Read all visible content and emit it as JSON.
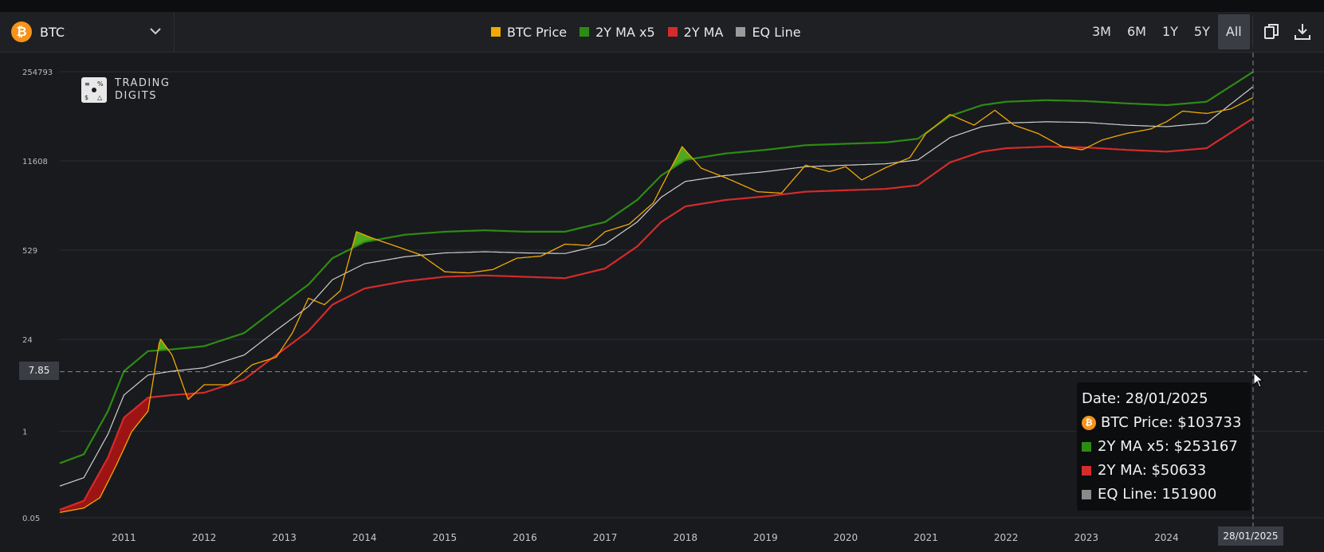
{
  "toolbar": {
    "asset": "BTC",
    "coin_symbol": "₿",
    "legend": [
      {
        "label": "BTC Price",
        "color": "#f2a900"
      },
      {
        "label": "2Y MA x5",
        "color": "#2e8b12"
      },
      {
        "label": "2Y MA",
        "color": "#d42b2b"
      },
      {
        "label": "EQ Line",
        "color": "#9a9a9a"
      }
    ],
    "ranges": [
      "3M",
      "6M",
      "1Y",
      "5Y",
      "All"
    ],
    "active_range": "All",
    "tools": [
      "copy-icon",
      "download-icon"
    ]
  },
  "watermark": {
    "line1": "TRADING",
    "line2": "DIGITS"
  },
  "crosshair": {
    "y_value": "7.85",
    "date": "28/01/2025"
  },
  "tooltip": {
    "date": "Date: 28/01/2025",
    "btc_price": "BTC Price: $103733",
    "ma5": "2Y MA x5: $253167",
    "ma": "2Y MA: $50633",
    "eq": "EQ Line: 151900"
  },
  "chart_data": {
    "type": "line",
    "y_scale": "log",
    "ylim": [
      0.05,
      254793
    ],
    "ytick_labels": [
      "254793",
      "11608",
      "529",
      "24",
      "1",
      "0.05"
    ],
    "xtick_labels": [
      "2011",
      "2012",
      "2013",
      "2014",
      "2015",
      "2016",
      "2017",
      "2018",
      "2019",
      "2020",
      "2021",
      "2022",
      "2023",
      "2024"
    ],
    "x_range": [
      2010.2,
      2025.08
    ],
    "grid": true,
    "legend_position": "top-center",
    "series": [
      {
        "name": "2Y MA x5",
        "color": "#2e8b12",
        "x": [
          2010.2,
          2010.5,
          2010.8,
          2011.0,
          2011.3,
          2011.6,
          2012.0,
          2012.5,
          2012.9,
          2013.3,
          2013.6,
          2014.0,
          2014.5,
          2015.0,
          2015.5,
          2016.0,
          2016.5,
          2017.0,
          2017.4,
          2017.7,
          2018.0,
          2018.5,
          2019.0,
          2019.5,
          2020.0,
          2020.5,
          2020.9,
          2021.3,
          2021.7,
          2022.0,
          2022.5,
          2023.0,
          2023.5,
          2024.0,
          2024.5,
          2025.08
        ],
        "values": [
          0.33,
          0.45,
          2.0,
          8.0,
          16,
          17,
          19,
          30,
          70,
          160,
          400,
          700,
          900,
          1000,
          1050,
          1000,
          1000,
          1400,
          3000,
          7000,
          12000,
          15000,
          17000,
          20000,
          21000,
          22000,
          25000,
          55000,
          80000,
          90000,
          95000,
          92000,
          85000,
          80000,
          90000,
          253167
        ]
      },
      {
        "name": "EQ Line",
        "color": "#cfcfcf",
        "x": [
          2010.2,
          2010.5,
          2010.8,
          2011.0,
          2011.3,
          2011.6,
          2012.0,
          2012.5,
          2012.9,
          2013.3,
          2013.6,
          2014.0,
          2014.5,
          2015.0,
          2015.5,
          2016.0,
          2016.5,
          2017.0,
          2017.4,
          2017.7,
          2018.0,
          2018.5,
          2019.0,
          2019.5,
          2020.0,
          2020.5,
          2020.9,
          2021.3,
          2021.7,
          2022.0,
          2022.5,
          2023.0,
          2023.5,
          2024.0,
          2024.5,
          2025.08
        ],
        "values": [
          0.15,
          0.2,
          0.9,
          3.5,
          7,
          8,
          9,
          14,
          33,
          75,
          190,
          330,
          420,
          480,
          500,
          480,
          470,
          650,
          1400,
          3300,
          5700,
          7000,
          8000,
          9500,
          10000,
          10500,
          12000,
          26000,
          38000,
          43000,
          45000,
          44000,
          40000,
          38000,
          43000,
          151900
        ]
      },
      {
        "name": "2Y MA",
        "color": "#d42b2b",
        "x": [
          2010.2,
          2010.5,
          2010.8,
          2011.0,
          2011.3,
          2011.6,
          2012.0,
          2012.5,
          2012.9,
          2013.3,
          2013.6,
          2014.0,
          2014.5,
          2015.0,
          2015.5,
          2016.0,
          2016.5,
          2017.0,
          2017.4,
          2017.7,
          2018.0,
          2018.5,
          2019.0,
          2019.5,
          2020.0,
          2020.5,
          2020.9,
          2021.3,
          2021.7,
          2022.0,
          2022.5,
          2023.0,
          2023.5,
          2024.0,
          2024.5,
          2025.08
        ],
        "values": [
          0.066,
          0.09,
          0.4,
          1.6,
          3.2,
          3.5,
          3.8,
          6,
          14,
          32,
          80,
          140,
          180,
          210,
          220,
          210,
          200,
          280,
          600,
          1400,
          2400,
          3000,
          3400,
          4000,
          4200,
          4400,
          5000,
          11000,
          16000,
          18000,
          19000,
          18500,
          17000,
          16000,
          18000,
          50633
        ]
      },
      {
        "name": "BTC Price",
        "color": "#f2a900",
        "x": [
          2010.2,
          2010.5,
          2010.7,
          2010.9,
          2011.1,
          2011.3,
          2011.45,
          2011.6,
          2011.8,
          2012.0,
          2012.3,
          2012.6,
          2012.9,
          2013.1,
          2013.3,
          2013.5,
          2013.7,
          2013.9,
          2014.1,
          2014.4,
          2014.7,
          2015.0,
          2015.3,
          2015.6,
          2015.9,
          2016.2,
          2016.5,
          2016.8,
          2017.0,
          2017.3,
          2017.6,
          2017.96,
          2018.2,
          2018.5,
          2018.9,
          2019.2,
          2019.5,
          2019.8,
          2020.0,
          2020.2,
          2020.5,
          2020.8,
          2021.0,
          2021.3,
          2021.6,
          2021.86,
          2022.1,
          2022.4,
          2022.7,
          2022.95,
          2023.2,
          2023.5,
          2023.8,
          2024.0,
          2024.2,
          2024.5,
          2024.8,
          2025.08
        ],
        "values": [
          0.06,
          0.07,
          0.1,
          0.3,
          1,
          2,
          25,
          14,
          3,
          5,
          5,
          10,
          13,
          30,
          100,
          80,
          130,
          1000,
          800,
          600,
          450,
          250,
          240,
          270,
          400,
          430,
          650,
          620,
          1000,
          1300,
          2700,
          19000,
          9000,
          6500,
          4000,
          3800,
          10000,
          8000,
          9500,
          6000,
          9200,
          13000,
          30000,
          58000,
          40000,
          67000,
          40000,
          30000,
          19000,
          17000,
          24000,
          30000,
          35000,
          45000,
          65000,
          60000,
          70000,
          103733
        ]
      }
    ]
  }
}
